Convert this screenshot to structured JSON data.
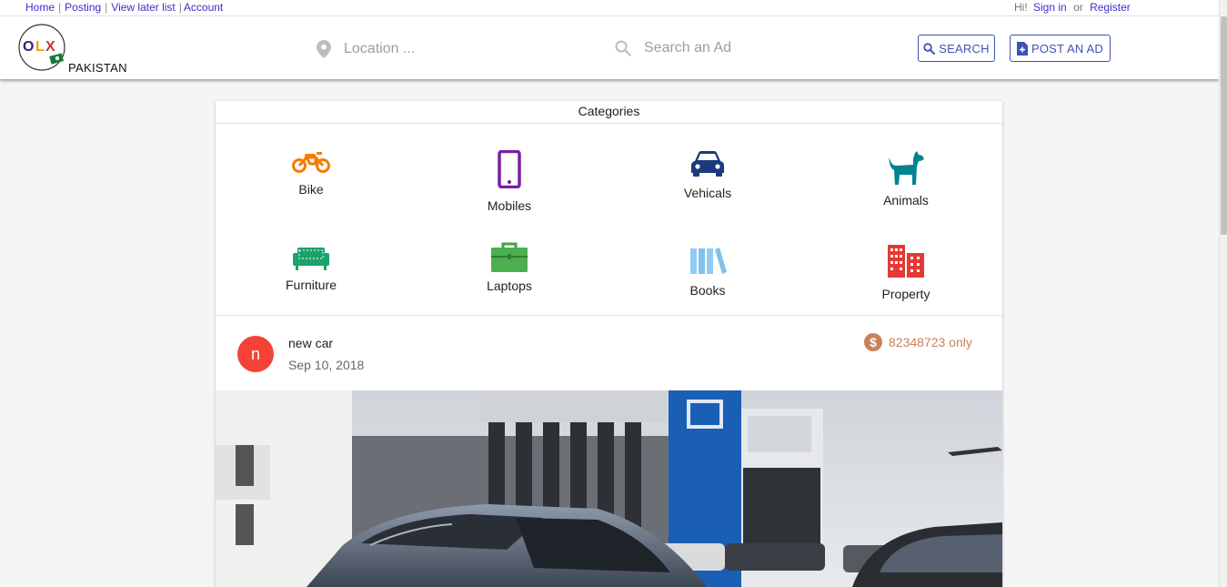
{
  "toplinks": {
    "home": "Home",
    "posting": "Posting",
    "view_later": "View later list",
    "account": "Account",
    "greeting": "Hi!",
    "sign_in": "Sign in",
    "or": "or",
    "register": "Register"
  },
  "header": {
    "logo_text": "OLX",
    "country": "PAKISTAN",
    "location_placeholder": "Location ...",
    "search_placeholder": "Search an Ad",
    "search_button": "SEARCH",
    "post_button": "POST AN AD"
  },
  "categories": {
    "title": "Categories",
    "items": [
      {
        "label": "Bike",
        "icon": "motorcycle-icon",
        "color": "#f57c00"
      },
      {
        "label": "Mobiles",
        "icon": "phone-icon",
        "color": "#7b1fa2"
      },
      {
        "label": "Vehicals",
        "icon": "car-icon",
        "color": "#1a3a7c"
      },
      {
        "label": "Animals",
        "icon": "dog-icon",
        "color": "#00838f"
      },
      {
        "label": "Furniture",
        "icon": "sofa-icon",
        "color": "#1aa36b"
      },
      {
        "label": "Laptops",
        "icon": "briefcase-icon",
        "color": "#4caf50"
      },
      {
        "label": "Books",
        "icon": "books-icon",
        "color": "#81c1e8"
      },
      {
        "label": "Property",
        "icon": "building-icon",
        "color": "#e53935"
      }
    ]
  },
  "ad": {
    "avatar_letter": "n",
    "title": "new car",
    "date": "Sep 10, 2018",
    "price": "82348723 only",
    "avatar_color": "#f44336",
    "price_color": "#c7825a"
  }
}
